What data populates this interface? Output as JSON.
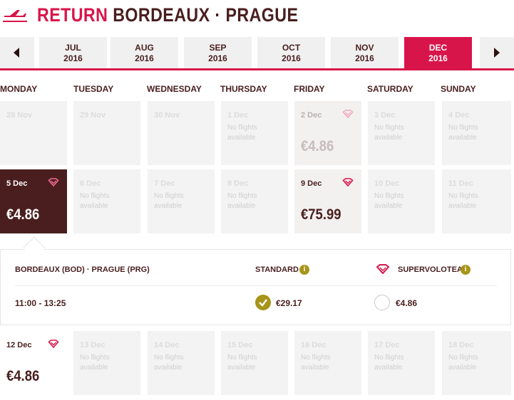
{
  "header": {
    "return_label": "RETURN",
    "route": "BORDEAUX · PRAGUE",
    "icon": "plane-icon",
    "accent": "#d8154a",
    "text_color": "#4a1e1e"
  },
  "months": [
    {
      "month": "JUL",
      "year": "2016",
      "active": false
    },
    {
      "month": "AUG",
      "year": "2016",
      "active": false
    },
    {
      "month": "SEP",
      "year": "2016",
      "active": false
    },
    {
      "month": "OCT",
      "year": "2016",
      "active": false
    },
    {
      "month": "NOV",
      "year": "2016",
      "active": false
    },
    {
      "month": "DEC",
      "year": "2016",
      "active": true
    }
  ],
  "weekdays": [
    "MONDAY",
    "TUESDAY",
    "WEDNESDAY",
    "THURSDAY",
    "FRIDAY",
    "SATURDAY",
    "SUNDAY"
  ],
  "weeks": [
    [
      {
        "date": "28 Nov"
      },
      {
        "date": "29 Nov"
      },
      {
        "date": "30 Nov"
      },
      {
        "date": "1 Dec",
        "note": "No flights available"
      },
      {
        "date": "2 Dec",
        "price": "€4.86",
        "faded": true,
        "gem": true
      },
      {
        "date": "3 Dec",
        "note": "No flights available"
      },
      {
        "date": "4 Dec",
        "note": "No flights available"
      }
    ],
    [
      {
        "date": "5 Dec",
        "price": "€4.86",
        "selected": true,
        "gem": true
      },
      {
        "date": "6 Dec",
        "note": "No flights available"
      },
      {
        "date": "7 Dec",
        "note": "No flights available"
      },
      {
        "date": "8 Dec",
        "note": "No flights available"
      },
      {
        "date": "9 Dec",
        "price": "€75.99",
        "gem": true
      },
      {
        "date": "10 Dec",
        "note": "No flights available"
      },
      {
        "date": "11 Dec",
        "note": "No flights available"
      }
    ],
    [
      {
        "date": "12 Dec",
        "price": "€4.86",
        "gem": true,
        "plain": true
      },
      {
        "date": "13 Dec",
        "note": "No flights available"
      },
      {
        "date": "14 Dec",
        "note": "No flights available"
      },
      {
        "date": "15 Dec",
        "note": "No flights available"
      },
      {
        "date": "16 Dec",
        "note": "No flights available"
      },
      {
        "date": "17 Dec",
        "note": "No flights available"
      },
      {
        "date": "18 Dec",
        "note": "No flights available"
      }
    ]
  ],
  "detail": {
    "route": "BORDEAUX (BOD) · PRAGUE (PRG)",
    "standard_label": "STANDARD",
    "supervolotea_label": "SUPERVOLOTEA",
    "time": "11:00 - 13:25",
    "standard_price": "€29.17",
    "standard_selected": true,
    "supervolotea_price": "€4.86",
    "supervolotea_selected": false,
    "info_icon": "i"
  },
  "colors": {
    "selected_bg": "#4a1e1e",
    "gold": "#a79419",
    "cell_bg": "#f3f3f3"
  }
}
